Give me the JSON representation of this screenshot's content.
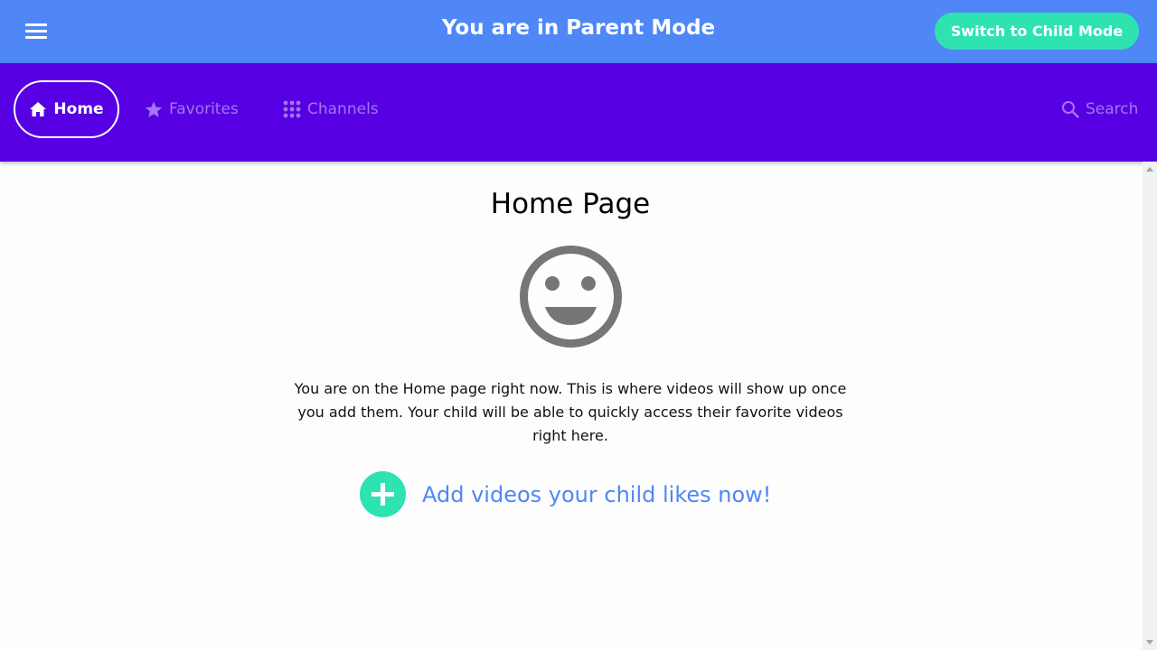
{
  "topbar": {
    "title": "You are in Parent Mode",
    "switch_label": "Switch to Child Mode",
    "menu_icon": "hamburger-menu-icon"
  },
  "nav": {
    "items": [
      {
        "label": "Home",
        "icon": "home-icon",
        "active": true
      },
      {
        "label": "Favorites",
        "icon": "star-icon",
        "active": false
      },
      {
        "label": "Channels",
        "icon": "grid-icon",
        "active": false
      }
    ],
    "search_label": "Search",
    "search_icon": "search-icon"
  },
  "main": {
    "title": "Home Page",
    "illustration_icon": "smiley-face-icon",
    "description": "You are on the Home page right now. This is where videos will show up once you add them. Your child will be able to quickly access their favorite videos right here.",
    "add_link": "Add videos your child likes now!",
    "add_icon": "plus-circle-icon"
  },
  "colors": {
    "topbar": "#4f87f6",
    "navbar": "#5600e3",
    "accent": "#2ee3b0",
    "link": "#4f87f6",
    "nav_inactive": "#a277f3"
  }
}
